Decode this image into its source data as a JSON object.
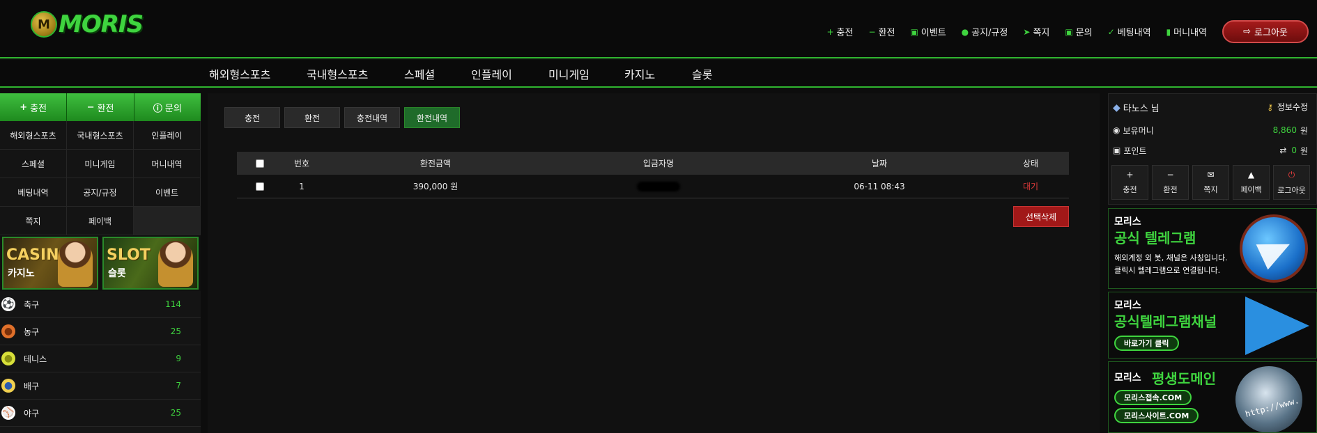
{
  "brand": {
    "logo_badge": "M",
    "logo_text": "MORIS",
    "accent": "#2fb52f"
  },
  "topnav": {
    "items": [
      {
        "icon": "plus-icon",
        "glyph": "+",
        "label": "충전"
      },
      {
        "icon": "minus-icon",
        "glyph": "−",
        "label": "환전"
      },
      {
        "icon": "calendar-icon",
        "glyph": "▣",
        "label": "이벤트"
      },
      {
        "icon": "info-icon",
        "glyph": "●",
        "label": "공지/규정"
      },
      {
        "icon": "paper-plane-icon",
        "glyph": "➤",
        "label": "쪽지"
      },
      {
        "icon": "edit-icon",
        "glyph": "▣",
        "label": "문의"
      },
      {
        "icon": "check-icon",
        "glyph": "✓",
        "label": "베팅내역"
      },
      {
        "icon": "clipboard-icon",
        "glyph": "▮",
        "label": "머니내역"
      }
    ],
    "logout_label": "로그아웃"
  },
  "categories": [
    "해외형스포츠",
    "국내형스포츠",
    "스페셜",
    "인플레이",
    "미니게임",
    "카지노",
    "슬롯"
  ],
  "leftbar": {
    "quick": [
      {
        "glyph": "+",
        "label": "충전"
      },
      {
        "glyph": "−",
        "label": "환전"
      },
      {
        "glyph": "ⓘ",
        "label": "문의"
      }
    ],
    "menu": [
      "해외형스포츠",
      "국내형스포츠",
      "인플레이",
      "스페셜",
      "미니게임",
      "머니내역",
      "베팅내역",
      "공지/규정",
      "이벤트",
      "쪽지",
      "페이백",
      ""
    ],
    "banners": [
      {
        "big": "CASINO",
        "small": "카지노"
      },
      {
        "big": "SLOT",
        "small": "슬롯"
      }
    ],
    "sports": [
      {
        "name": "축구",
        "count": "114",
        "glyph": "⚽"
      },
      {
        "name": "농구",
        "count": "25",
        "glyph": "●"
      },
      {
        "name": "테니스",
        "count": "9",
        "glyph": "●"
      },
      {
        "name": "배구",
        "count": "7",
        "glyph": "●"
      },
      {
        "name": "야구",
        "count": "25",
        "glyph": "⚾"
      }
    ]
  },
  "main": {
    "tabs": [
      "충전",
      "환전",
      "충전내역",
      "환전내역"
    ],
    "active_tab": "환전내역",
    "columns": [
      "번호",
      "환전금액",
      "입금자명",
      "날짜",
      "상태"
    ],
    "rows": [
      {
        "no": "1",
        "amount": "390,000 원",
        "name": "",
        "date": "06-11 08:43",
        "status": "대기"
      }
    ],
    "delete_label": "선택삭제"
  },
  "rightbar": {
    "username": "타노스 님",
    "edit_label": "정보수정",
    "money_label": "보유머니",
    "money_value": "8,860",
    "money_unit": "원",
    "point_label": "포인트",
    "point_value": "0",
    "point_unit": "원",
    "actions": [
      {
        "glyph": "+",
        "label": "충전"
      },
      {
        "glyph": "−",
        "label": "환전"
      },
      {
        "glyph": "✉",
        "label": "쪽지"
      },
      {
        "glyph": "▲",
        "label": "페이백"
      },
      {
        "glyph": "⏻",
        "label": "로그아웃"
      }
    ],
    "promos": [
      {
        "t1": "모리스",
        "t2": "공식 텔레그램",
        "t3a": "해외계정 외 봇, 채널은 사칭입니다.",
        "t3b": "클릭시 텔레그램으로 연결됩니다."
      },
      {
        "t1": "모리스",
        "t2": "공식텔레그램채널",
        "pill": "바로가기 클릭"
      },
      {
        "t1": "모리스",
        "t2": "평생도메인",
        "pill1": "모리스접속.COM",
        "pill2": "모리스사이트.COM",
        "globe_text": "http://www."
      }
    ]
  }
}
